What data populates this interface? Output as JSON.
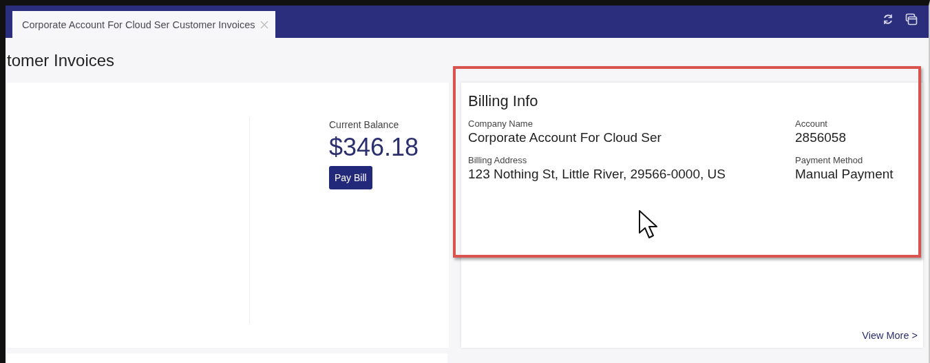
{
  "tabs": [
    {
      "label": "Corporate Account For Cloud Ser Customer Invoices",
      "selected": true
    }
  ],
  "page_title": "tomer Invoices",
  "balance": {
    "label": "Current Balance",
    "amount": "$346.18",
    "button": "Pay Bill"
  },
  "billing_info": {
    "title": "Billing Info",
    "fields": [
      {
        "label": "Company Name",
        "value": "Corporate Account For Cloud Ser"
      },
      {
        "label": "Account",
        "value": "2856058"
      },
      {
        "label": "Billing Address",
        "value": "123 Nothing St, Little River, 29566-0000, US"
      },
      {
        "label": "Payment Method",
        "value": "Manual Payment"
      }
    ],
    "link": "View More >"
  }
}
